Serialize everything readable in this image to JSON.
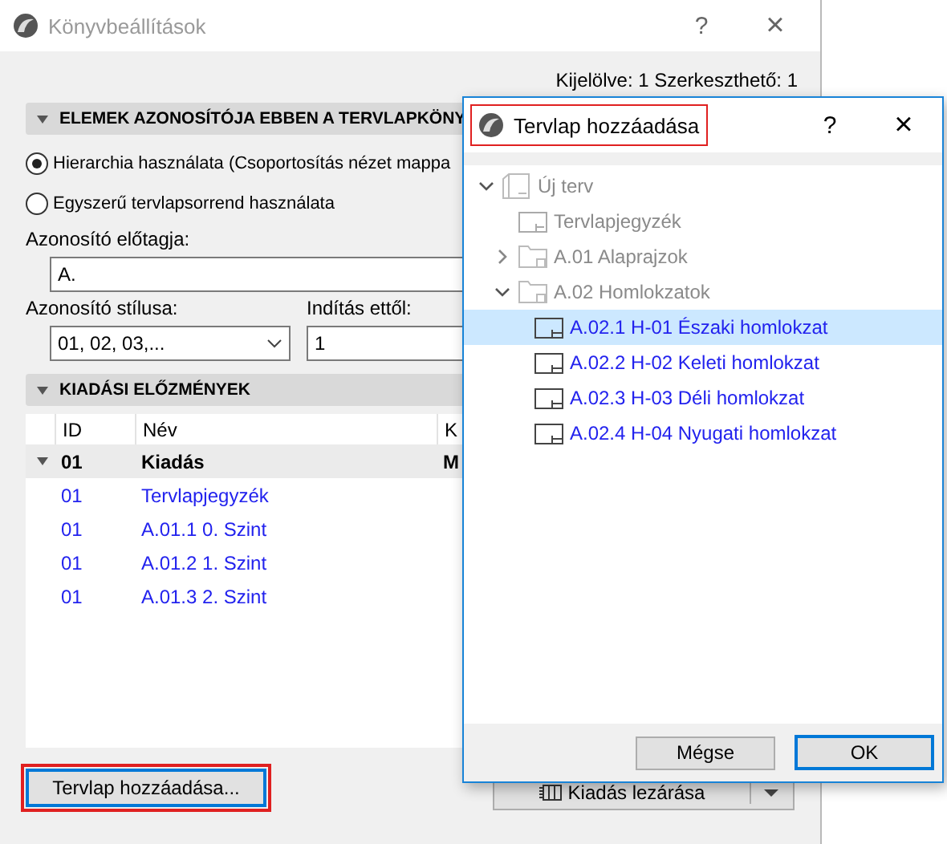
{
  "main_window": {
    "title": "Könyvbeállítások",
    "help": "?",
    "close": "×",
    "selection_info": "Kijelölve: 1 Szerkeszthető: 1",
    "sections": [
      {
        "title": "ELEMEK AZONOSÍTÓJA EBBEN A TERVLAPKÖNY",
        "expanded": true
      },
      {
        "title": "KIADÁSI ELŐZMÉNYEK",
        "expanded": true
      }
    ],
    "radios": [
      {
        "label": "Hierarchia használata (Csoportosítás nézet mappa",
        "selected": true
      },
      {
        "label": "Egyszerű tervlapsorrend használata",
        "selected": false
      }
    ],
    "prefix": {
      "label": "Azonosító előtagja:",
      "value": "A."
    },
    "style": {
      "label": "Azonosító stílusa:",
      "value": "01, 02, 03,..."
    },
    "start": {
      "label": "Indítás ettől:",
      "value": "1"
    },
    "table": {
      "columns": [
        "ID",
        "Név",
        "K"
      ],
      "rows": [
        {
          "kind": "group",
          "expanded": true,
          "cells": [
            "01",
            "Kiadás",
            "M"
          ]
        },
        {
          "kind": "sheet",
          "cells": [
            "01",
            "Tervlapjegyzék"
          ]
        },
        {
          "kind": "sheet",
          "cells": [
            "01",
            "A.01.1 0. Szint"
          ]
        },
        {
          "kind": "sheet",
          "cells": [
            "01",
            "A.01.2 1. Szint"
          ]
        },
        {
          "kind": "sheet",
          "cells": [
            "01",
            "A.01.3 2. Szint"
          ]
        }
      ]
    },
    "add_button": "Tervlap hozzáadása...",
    "close_issue_button": "Kiadás lezárása"
  },
  "dialog": {
    "title": "Tervlap hozzáadása",
    "help": "?",
    "close": "×",
    "tree": [
      {
        "kind": "book",
        "label": "Új terv",
        "expanded": true,
        "disabled": true,
        "selected": false,
        "children": [
          {
            "kind": "index",
            "label": "Tervlapjegyzék",
            "disabled": true,
            "selected": false
          },
          {
            "kind": "folder",
            "label": "A.01 Alaprajzok",
            "expanded": false,
            "disabled": true,
            "selected": false
          },
          {
            "kind": "folder",
            "label": "A.02 Homlokzatok",
            "expanded": true,
            "disabled": true,
            "selected": false,
            "children": [
              {
                "kind": "sheet",
                "label": "A.02.1 H-01 Északi homlokzat",
                "disabled": false,
                "selected": true
              },
              {
                "kind": "sheet",
                "label": "A.02.2 H-02 Keleti homlokzat",
                "disabled": false,
                "selected": false
              },
              {
                "kind": "sheet",
                "label": "A.02.3 H-03 Déli homlokzat",
                "disabled": false,
                "selected": false
              },
              {
                "kind": "sheet",
                "label": "A.02.4 H-04 Nyugati homlokzat",
                "disabled": false,
                "selected": false
              }
            ]
          }
        ]
      }
    ],
    "buttons": [
      {
        "label": "Mégse",
        "default": false
      },
      {
        "label": "OK",
        "default": true
      }
    ]
  }
}
